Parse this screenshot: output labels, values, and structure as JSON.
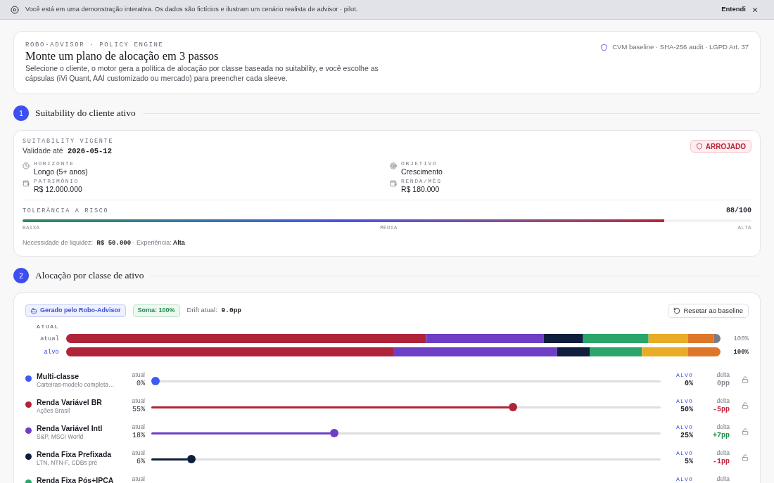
{
  "banner": {
    "text": "Você está em uma demonstração interativa. Os dados são fictícios e ilustram um cenário realista de advisor · pilot.",
    "action": "Entendi"
  },
  "header": {
    "eyebrow": "ROBO-ADVISOR · POLICY ENGINE",
    "title": "Monte um plano de alocação em 3 passos",
    "description": "Selecione o cliente, o motor gera a política de alocação por classe baseada no suitability, e você escolhe as cápsulas (iVi Quant, AAI customizado ou mercado) para preencher cada sleeve.",
    "compliance": "CVM baseline · SHA-256 audit · LGPD Art. 37"
  },
  "suitability_step": {
    "number": "1",
    "title": "Suitability do cliente ativo",
    "eyebrow": "SUITABILITY VIGENTE",
    "validity": [
      {
        "kind": "text",
        "text": "Validade até"
      },
      {
        "kind": "code",
        "text": "2026-05-12"
      }
    ],
    "profile_badge": "ARROJADO",
    "facts": [
      {
        "label": "HORIZONTE",
        "value": "Longo (5+ anos)"
      },
      {
        "label": "OBJETIVO",
        "value": "Crescimento"
      },
      {
        "label": "PATRIMÔNIO",
        "value": "R$ 12.000.000"
      },
      {
        "label": "RENDA/MÊS",
        "value": "R$ 180.000"
      }
    ],
    "risk": {
      "label": "TOLERÂNCIA A RISCO",
      "score": "88/100",
      "level": 0.88,
      "scale": [
        "BAIXA",
        "MÉDIA",
        "ALTA"
      ]
    },
    "note": [
      {
        "kind": "text",
        "text": "Necessidade de liquidez:"
      },
      {
        "kind": "code",
        "text": "R$ 50.000"
      },
      {
        "kind": "text",
        "text": "· Experiência:"
      },
      {
        "kind": "strong",
        "text": "Alta"
      }
    ]
  },
  "allocation_step": {
    "number": "2",
    "title": "Alocação por classe de ativo",
    "chips": [
      {
        "kind": "source",
        "text": "Gerado pelo Robo-Advisor"
      },
      {
        "kind": "sum",
        "text": "Soma: 100%"
      }
    ],
    "drift": [
      {
        "kind": "text",
        "text": "Drift atual:"
      },
      {
        "kind": "code",
        "text": "9.0pp"
      }
    ],
    "reset_button": "Resetar ao baseline",
    "bars_heading": "ATUAL",
    "bars": [
      {
        "kind": "current",
        "label": "atual",
        "total": "100%"
      },
      {
        "kind": "target",
        "label": "alvo",
        "total": "100%"
      }
    ],
    "classes": [
      {
        "name": "Multi-classe",
        "detail": "Carteiras-modelo completa…",
        "color": "#3d5af1",
        "current_label": "atual",
        "current": "0%",
        "level": 0,
        "target_label": "ALVO",
        "target": "0%",
        "delta_label": "delta",
        "delta": "0pp",
        "kind": "flat",
        "locked": false
      },
      {
        "name": "Renda Variável BR",
        "detail": "Ações Brasil",
        "color": "#b0243a",
        "current_label": "atual",
        "current": "55%",
        "level": 0.714,
        "target_label": "ALVO",
        "target": "50%",
        "delta_label": "delta",
        "delta": "-5pp",
        "kind": "down",
        "locked": false
      },
      {
        "name": "Renda Variável Intl",
        "detail": "S&P, MSCI World",
        "color": "#6e3fc6",
        "current_label": "atual",
        "current": "18%",
        "level": 0.357,
        "target_label": "ALVO",
        "target": "25%",
        "delta_label": "delta",
        "delta": "+7pp",
        "kind": "up",
        "locked": false
      },
      {
        "name": "Renda Fixa Prefixada",
        "detail": "LTN, NTN-F, CDBs pré",
        "color": "#0f1e3d",
        "current_label": "atual",
        "current": "6%",
        "level": 0.071,
        "target_label": "ALVO",
        "target": "5%",
        "delta_label": "delta",
        "delta": "-1pp",
        "kind": "down",
        "locked": false
      },
      {
        "name": "Renda Fixa Pós+IPCA",
        "color": "#2ba66b",
        "current_label": "atual",
        "target_label": "ALVO",
        "delta_label": "delta"
      }
    ]
  }
}
